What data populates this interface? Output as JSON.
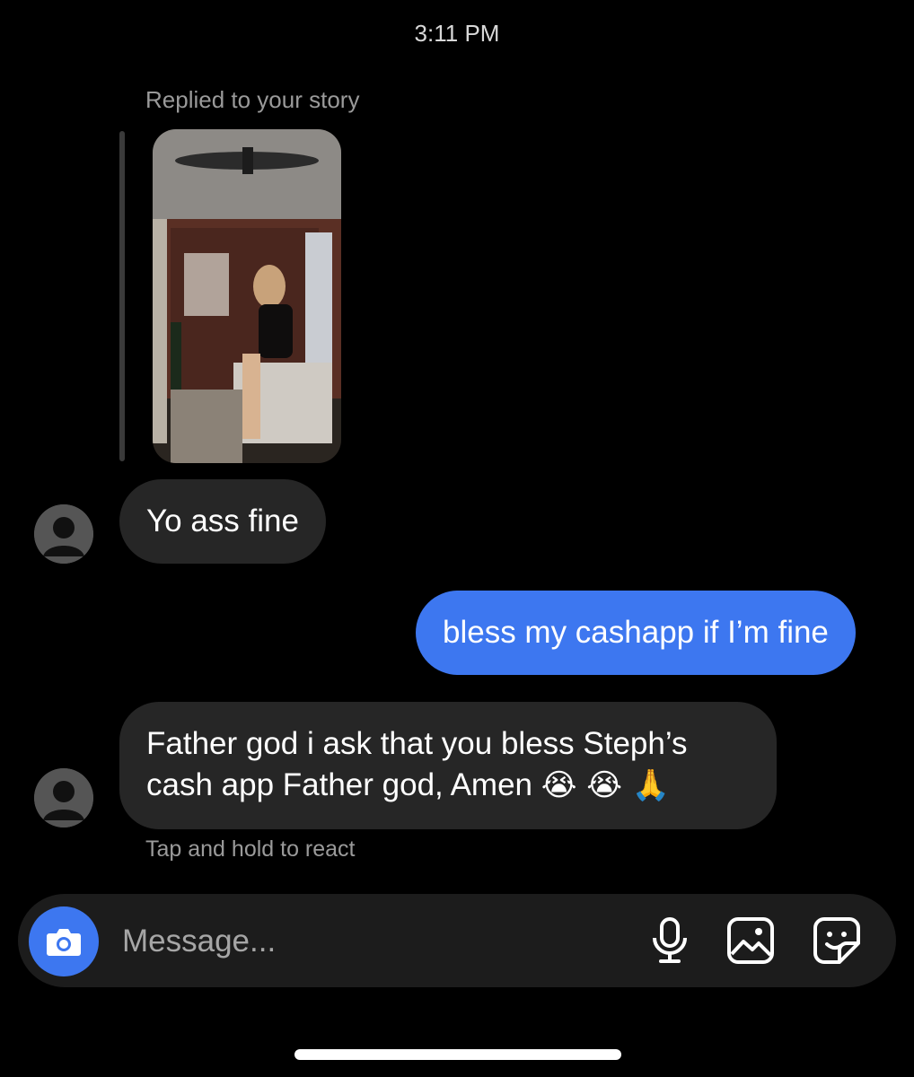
{
  "status": {
    "time": "3:11 PM"
  },
  "story_reply": {
    "caption": "Replied to your story"
  },
  "messages": [
    {
      "from": "them",
      "text": "Yo ass fine"
    },
    {
      "from": "me",
      "text": "bless my cashapp if I’m fine"
    },
    {
      "from": "them",
      "text_line1": "Father god i ask that you bless Steph’s",
      "text_line2": "cash app Father god, Amen",
      "emoji": "😭 😭 🙏"
    }
  ],
  "hint": "Tap and hold to react",
  "composer": {
    "placeholder": "Message..."
  },
  "icons": {
    "camera": "camera-icon",
    "mic": "microphone-icon",
    "gallery": "image-icon",
    "sticker": "sticker-icon"
  },
  "colors": {
    "accent": "#3d77f0",
    "bubble_in": "#262626",
    "background": "#000000"
  }
}
